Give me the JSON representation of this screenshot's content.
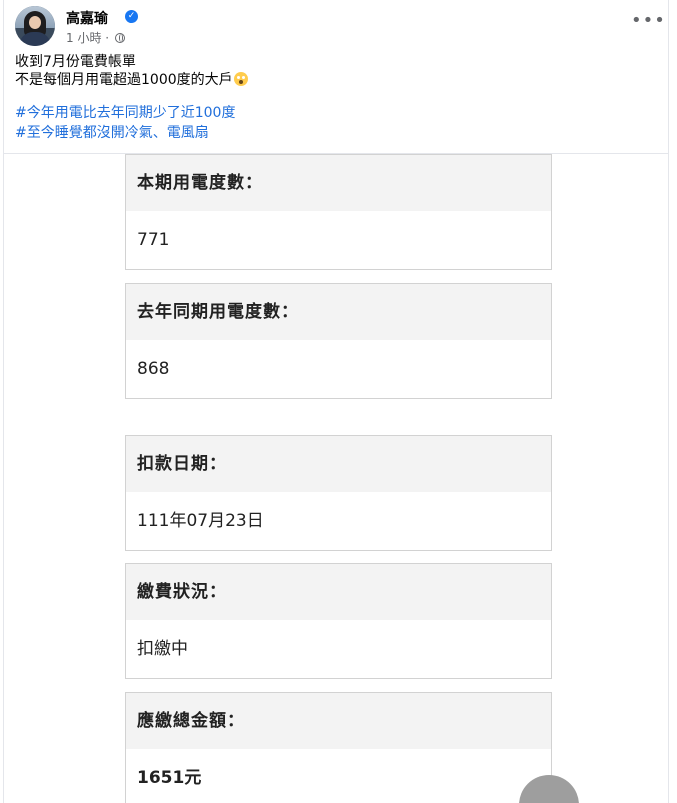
{
  "post": {
    "author": "高嘉瑜",
    "time": "1 小時",
    "separator": " · ",
    "text_lines": [
      "收到7月份電費帳單",
      "不是每個月用電超過1000度的大戶"
    ],
    "hashtags": [
      "#今年用電比去年同期少了近100度",
      "#至今睡覺都沒開冷氣、電風扇"
    ]
  },
  "bill": {
    "cards": [
      {
        "label": "本期用電度數：",
        "value": "771"
      },
      {
        "label": "去年同期用電度數：",
        "value": "868"
      },
      {
        "label": "扣款日期：",
        "value": "111年07月23日"
      },
      {
        "label": "繳費狀況：",
        "value": "扣繳中"
      },
      {
        "label": "應繳總金額：",
        "value": "1651元"
      }
    ]
  },
  "icons": {
    "verified": "verified-badge-icon",
    "privacy": "globe-icon",
    "more": "more-options-icon",
    "emoji": "face-screaming-emoji"
  },
  "colors": {
    "hashtag": "#216fdb",
    "verified": "#1877f2",
    "meta": "#65676b"
  }
}
